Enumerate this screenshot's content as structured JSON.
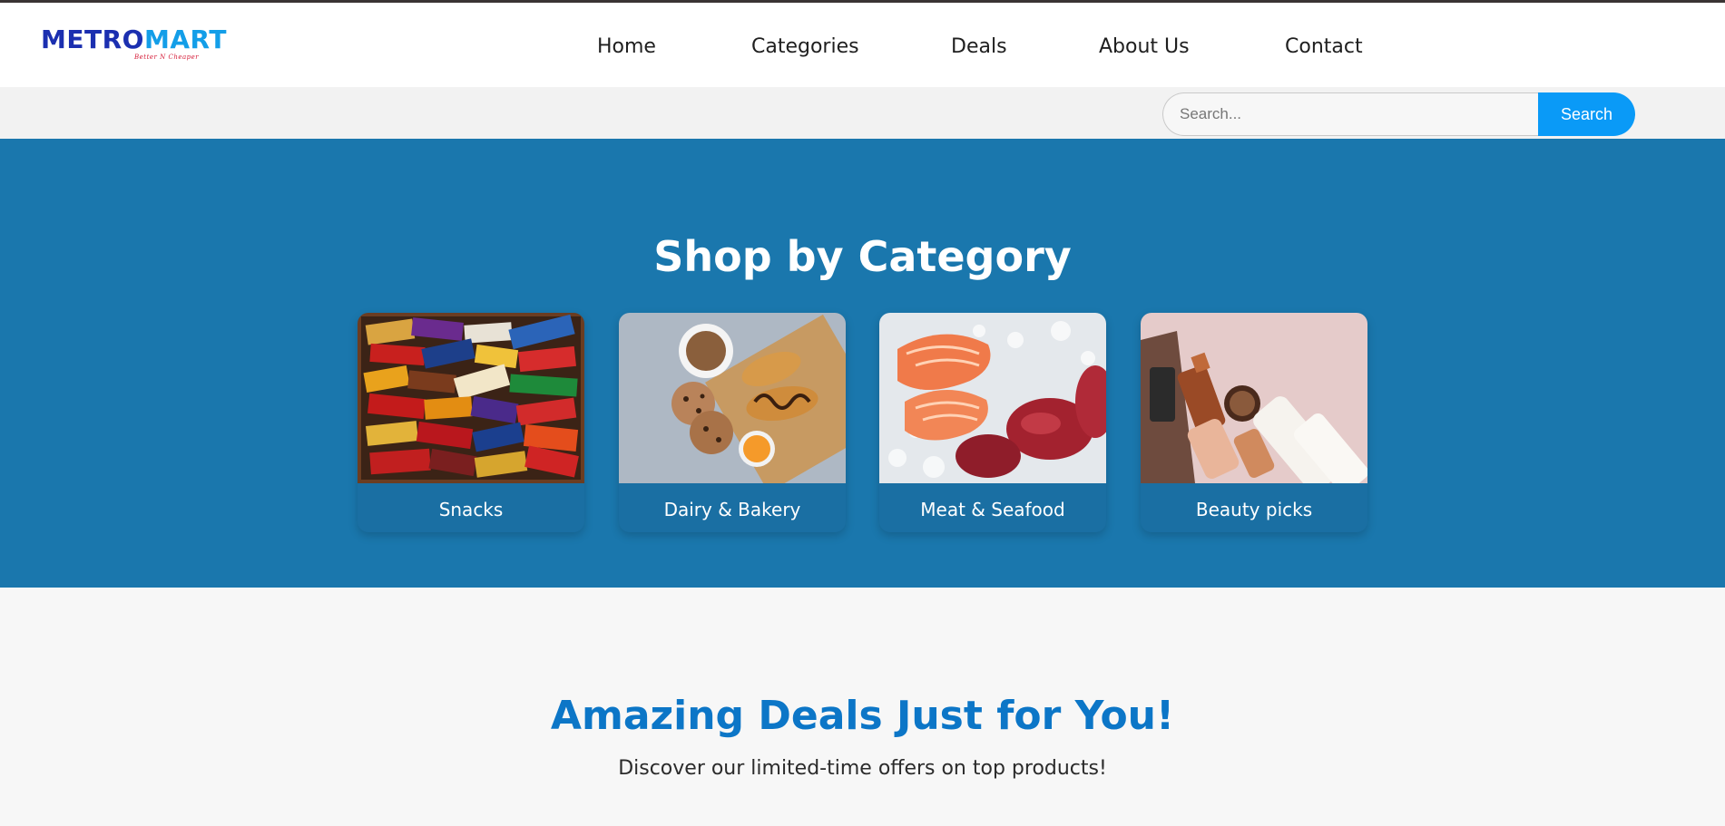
{
  "brand": {
    "logo_text": "METROMART",
    "tagline": "Better N Cheaper",
    "colors": {
      "primary": "#1b2fb0",
      "accent": "#139ee8",
      "tagline": "#d6203c"
    }
  },
  "nav": {
    "items": [
      {
        "label": "Home"
      },
      {
        "label": "Categories"
      },
      {
        "label": "Deals"
      },
      {
        "label": "About Us"
      },
      {
        "label": "Contact"
      }
    ]
  },
  "search": {
    "placeholder": "Search...",
    "value": "",
    "button_label": "Search",
    "button_color": "#0a9af7"
  },
  "categories": {
    "title": "Shop by Category",
    "background": "#1a77ad",
    "items": [
      {
        "label": "Snacks",
        "image_icon": "snacks-photo"
      },
      {
        "label": "Dairy & Bakery",
        "image_icon": "bakery-photo"
      },
      {
        "label": "Meat & Seafood",
        "image_icon": "seafood-photo"
      },
      {
        "label": "Beauty picks",
        "image_icon": "beauty-photo"
      }
    ]
  },
  "deals": {
    "title": "Amazing Deals Just for You!",
    "subtitle": "Discover our limited-time offers on top products!",
    "title_color": "#0c76c7"
  }
}
